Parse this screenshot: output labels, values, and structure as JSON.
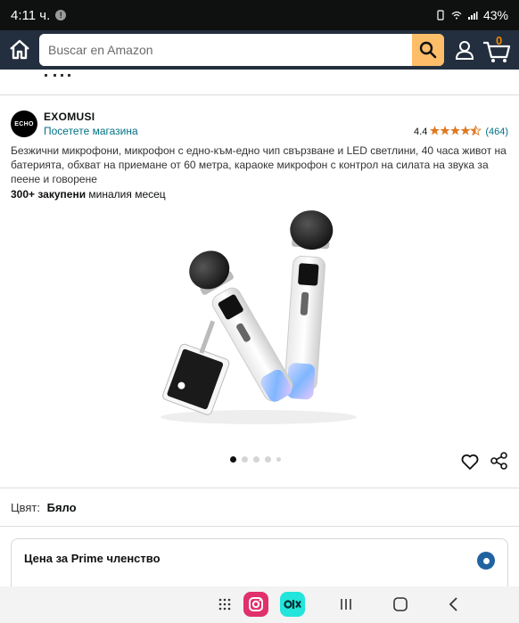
{
  "status": {
    "time": "4:11 ч.",
    "notification_badge": "!",
    "battery": "43%"
  },
  "header": {
    "search_placeholder": "Buscar en Amazon",
    "cart_count": "0"
  },
  "product": {
    "brand_name": "EXOMUSI",
    "brand_logo_text": "ECHO",
    "store_link": "Посетете магазина",
    "rating_value": "4.4",
    "rating_stars": "4.5 of 5",
    "rating_count": "(464)",
    "title": "Безжични микрофони, микрофон с едно-към-едно чип свързване и LED светлини, 40 часа живот на батерията, обхват на приемане от 60 метра, караоке микрофон с контрол на силата на звука за пеене и говорене",
    "bought_strong": "300+ закупени",
    "bought_rest": " миналия месец",
    "image_count": 5,
    "active_image": 1
  },
  "variation": {
    "label": "Цвят:",
    "value": "Бяло"
  },
  "price_option": {
    "title": "Цена за Prime членство",
    "selected": true
  },
  "colors": {
    "header_bg": "#232f3e",
    "search_button": "#febd69",
    "link": "#007185",
    "star": "#de7921",
    "radio": "#2162a1"
  }
}
